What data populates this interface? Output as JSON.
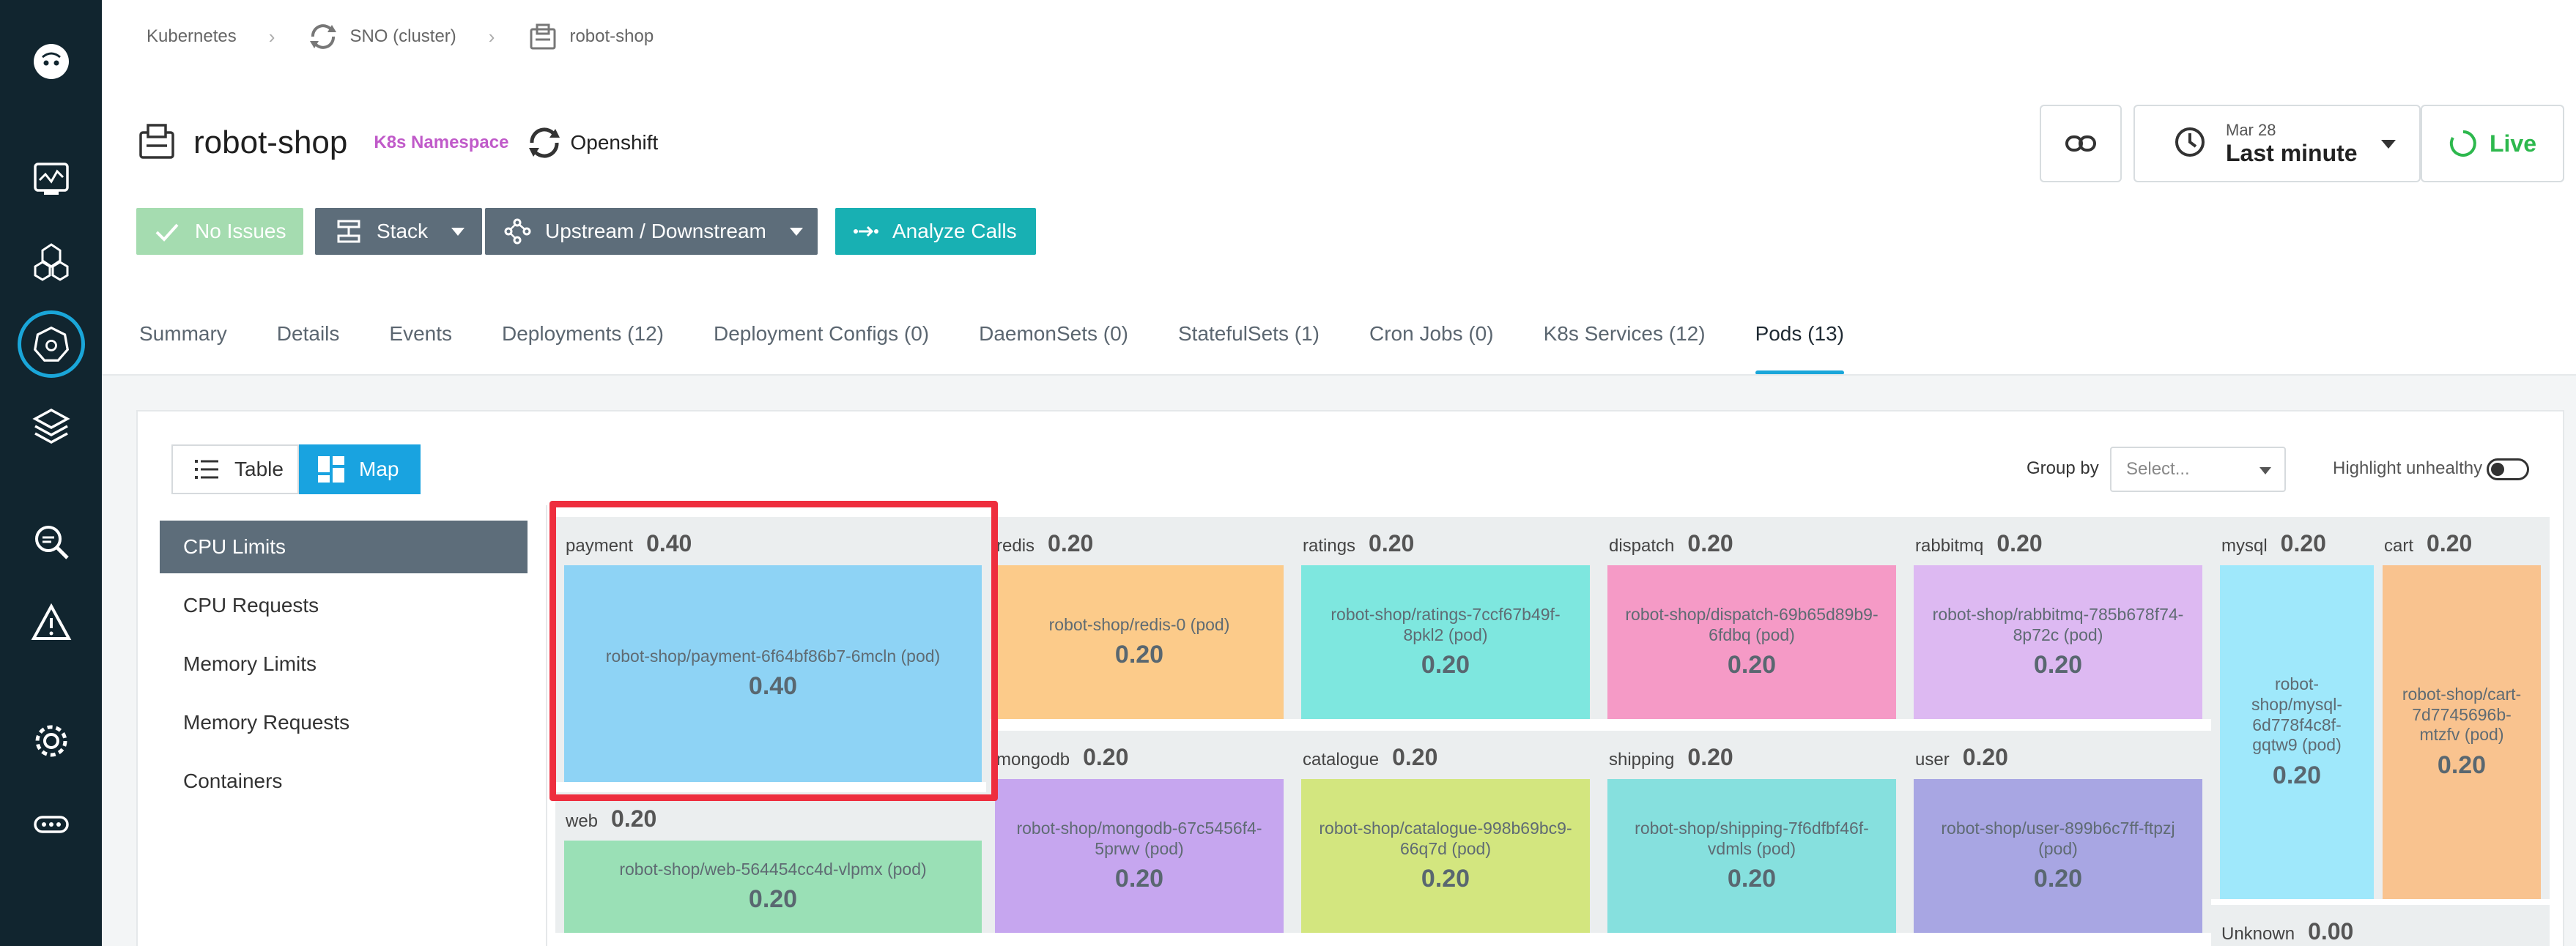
{
  "breadcrumb": [
    {
      "label": "Kubernetes"
    },
    {
      "label": "SNO (cluster)"
    },
    {
      "label": "robot-shop"
    }
  ],
  "header": {
    "title": "robot-shop",
    "badge": "K8s Namespace",
    "platform": "Openshift"
  },
  "time_picker": {
    "date": "Mar 28",
    "range": "Last minute"
  },
  "live_label": "Live",
  "actions": {
    "no_issues": "No Issues",
    "stack": "Stack",
    "upstream": "Upstream / Downstream",
    "analyze": "Analyze Calls"
  },
  "tabs": [
    {
      "label": "Summary"
    },
    {
      "label": "Details"
    },
    {
      "label": "Events"
    },
    {
      "label": "Deployments (12)"
    },
    {
      "label": "Deployment Configs (0)"
    },
    {
      "label": "DaemonSets (0)"
    },
    {
      "label": "StatefulSets (1)"
    },
    {
      "label": "Cron Jobs (0)"
    },
    {
      "label": "K8s Services (12)"
    },
    {
      "label": "Pods (13)"
    }
  ],
  "active_tab": "Pods (13)",
  "view_toggle": {
    "table": "Table",
    "map": "Map"
  },
  "group_by": {
    "label": "Group by",
    "placeholder": "Select..."
  },
  "highlight_unhealthy": "Highlight unhealthy",
  "metrics": [
    {
      "label": "CPU Limits"
    },
    {
      "label": "CPU Requests"
    },
    {
      "label": "Memory Limits"
    },
    {
      "label": "Memory Requests"
    },
    {
      "label": "Containers"
    }
  ],
  "active_metric": "CPU Limits",
  "treemap": [
    {
      "name": "payment",
      "value": "0.40",
      "pod": "robot-shop/payment-6f64bf86b7-6mcln (pod)",
      "color": "#8ed3f5"
    },
    {
      "name": "redis",
      "value": "0.20",
      "pod": "robot-shop/redis-0 (pod)",
      "color": "#fccb8a"
    },
    {
      "name": "ratings",
      "value": "0.20",
      "pod": "robot-shop/ratings-7ccf67b49f-8pkl2 (pod)",
      "color": "#7ee7df"
    },
    {
      "name": "dispatch",
      "value": "0.20",
      "pod": "robot-shop/dispatch-69b65d89b9-6fdbq (pod)",
      "color": "#f59ac6"
    },
    {
      "name": "rabbitmq",
      "value": "0.20",
      "pod": "robot-shop/rabbitmq-785b678f74-8p72c (pod)",
      "color": "#ddb9f2"
    },
    {
      "name": "mysql",
      "value": "0.20",
      "pod": "robot-shop/mysql-6d778f4c8f-gqtw9 (pod)",
      "color": "#9fe8fb"
    },
    {
      "name": "cart",
      "value": "0.20",
      "pod": "robot-shop/cart-7d7745696b-mtzfv (pod)",
      "color": "#f9c38f"
    },
    {
      "name": "mongodb",
      "value": "0.20",
      "pod": "robot-shop/mongodb-67c5456f4-5prwv (pod)",
      "color": "#c6a6ef"
    },
    {
      "name": "catalogue",
      "value": "0.20",
      "pod": "robot-shop/catalogue-998b69bc9-66q7d (pod)",
      "color": "#d3e67f"
    },
    {
      "name": "shipping",
      "value": "0.20",
      "pod": "robot-shop/shipping-7f6dfbf46f-vdmls (pod)",
      "color": "#86e0de"
    },
    {
      "name": "user",
      "value": "0.20",
      "pod": "robot-shop/user-899b6c7ff-ftpzj (pod)",
      "color": "#a8a6e3"
    },
    {
      "name": "web",
      "value": "0.20",
      "pod": "robot-shop/web-564454cc4d-vlpmx (pod)",
      "color": "#9ae0b6"
    },
    {
      "name": "Unknown",
      "value": "0.00",
      "pod": "",
      "color": "#ebeeef"
    }
  ]
}
